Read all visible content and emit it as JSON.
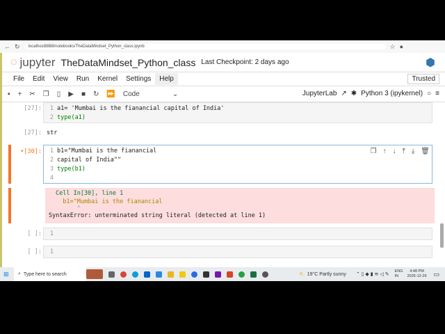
{
  "browser": {
    "url": "localhost8888/notebooks/TheDataMindset_Python_class.ipynb"
  },
  "header": {
    "logo": "jupyter",
    "title": "TheDataMindset_Python_class",
    "checkpoint": "Last Checkpoint: 2 days ago"
  },
  "menu": [
    "File",
    "Edit",
    "View",
    "Run",
    "Kernel",
    "Settings",
    "Help"
  ],
  "trusted": "Trusted",
  "toolbar": {
    "cell_type": "Code",
    "jupyterlab": "JupyterLab",
    "kernel": "Python 3 (ipykernel)"
  },
  "cells": [
    {
      "prompt": "[27]:",
      "lines": [
        "a1= 'Mumbai is the fianancial capital of India'",
        "type(a1)"
      ],
      "out_prompt": "[27]:",
      "output": "str"
    },
    {
      "prompt": "•[30]:",
      "lines": [
        "b1=\"Mumbai is the fianancial",
        "capital of India\"\"",
        "type(b1)",
        ""
      ],
      "error": [
        "Cell In[30], line 1",
        "  b1=\"Mumbai is the fianancial",
        "      ^",
        "SyntaxError: unterminated string literal (detected at line 1)"
      ]
    },
    {
      "prompt": "[ ]:",
      "lines": [
        ""
      ]
    },
    {
      "prompt": "[ ]:",
      "lines": [
        ""
      ]
    }
  ],
  "taskbar": {
    "search_placeholder": "Type here to search",
    "weather": "19°C  Partly sunny",
    "lang": "ENG",
    "region": "IN",
    "time": "4:48 PM",
    "date": "2025-12-26"
  },
  "colors": {
    "accent": "#f37726",
    "error_bg": "#fddddd"
  }
}
